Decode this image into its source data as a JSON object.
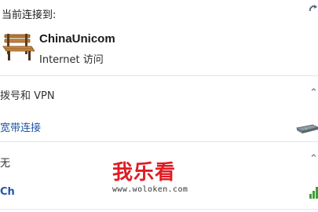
{
  "header": {
    "connected_label": "当前连接到:"
  },
  "current_network": {
    "name": "ChinaUnicom",
    "status": "Internet 访问",
    "icon": "bench-network-icon"
  },
  "sections": {
    "dialup_vpn": "拨号和 VPN",
    "broadband": "宽带连接",
    "wireless": "无",
    "bottom_partial": "Ch"
  },
  "watermark": {
    "title": "我乐看",
    "url": "www.woloken.com"
  },
  "colors": {
    "link": "#1f55a8",
    "watermark_red": "#df1c24",
    "divider": "#dfe4ea"
  }
}
